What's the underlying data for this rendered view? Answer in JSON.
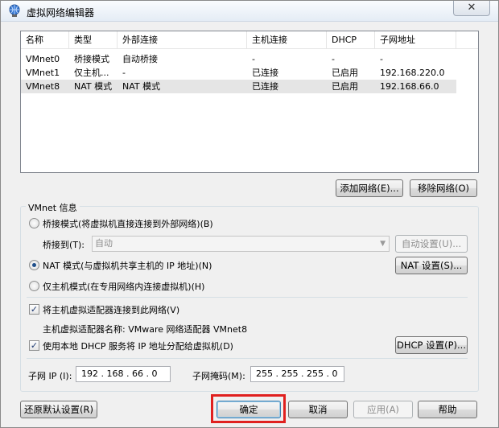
{
  "window": {
    "title": "虚拟网络编辑器",
    "close_glyph": "✕"
  },
  "table": {
    "columns": [
      "名称",
      "类型",
      "外部连接",
      "主机连接",
      "DHCP",
      "子网地址"
    ],
    "rows": [
      [
        "VMnet0",
        "桥接模式",
        "自动桥接",
        "-",
        "-",
        "-"
      ],
      [
        "VMnet1",
        "仅主机...",
        "-",
        "已连接",
        "已启用",
        "192.168.220.0"
      ],
      [
        "VMnet8",
        "NAT 模式",
        "NAT 模式",
        "已连接",
        "已启用",
        "192.168.66.0"
      ]
    ],
    "selected_row": "VMnet8"
  },
  "buttons": {
    "add_network": "添加网络(E)...",
    "remove_network": "移除网络(O)",
    "auto_settings": "自动设置(U)...",
    "nat_settings": "NAT 设置(S)...",
    "dhcp_settings": "DHCP 设置(P)...",
    "restore_defaults": "还原默认设置(R)",
    "ok": "确定",
    "cancel": "取消",
    "apply": "应用(A)",
    "help": "帮助"
  },
  "vmnet_info": {
    "group_title": "VMnet 信息",
    "bridged_label": "桥接模式(将虚拟机直接连接到外部网络)(B)",
    "bridged_to_label": "桥接到(T):",
    "bridged_to_value": "自动",
    "nat_label": "NAT 模式(与虚拟机共享主机的 IP 地址)(N)",
    "hostonly_label": "仅主机模式(在专用网络内连接虚拟机)(H)",
    "selected_mode": "NAT",
    "connect_adapter_label": "将主机虚拟适配器连接到此网络(V)",
    "connect_adapter_checked": true,
    "adapter_name_label": "主机虚拟适配器名称: VMware 网络适配器 VMnet8",
    "use_dhcp_label": "使用本地 DHCP 服务将 IP 地址分配给虚拟机(D)",
    "use_dhcp_checked": true,
    "subnet_ip_label": "子网 IP (I):",
    "subnet_ip_value": "192 . 168 . 66 . 0",
    "subnet_mask_label": "子网掩码(M):",
    "subnet_mask_value": "255 . 255 . 255 . 0"
  },
  "colors": {
    "highlight": "#e0201f",
    "selection": "#e5e5e5"
  }
}
